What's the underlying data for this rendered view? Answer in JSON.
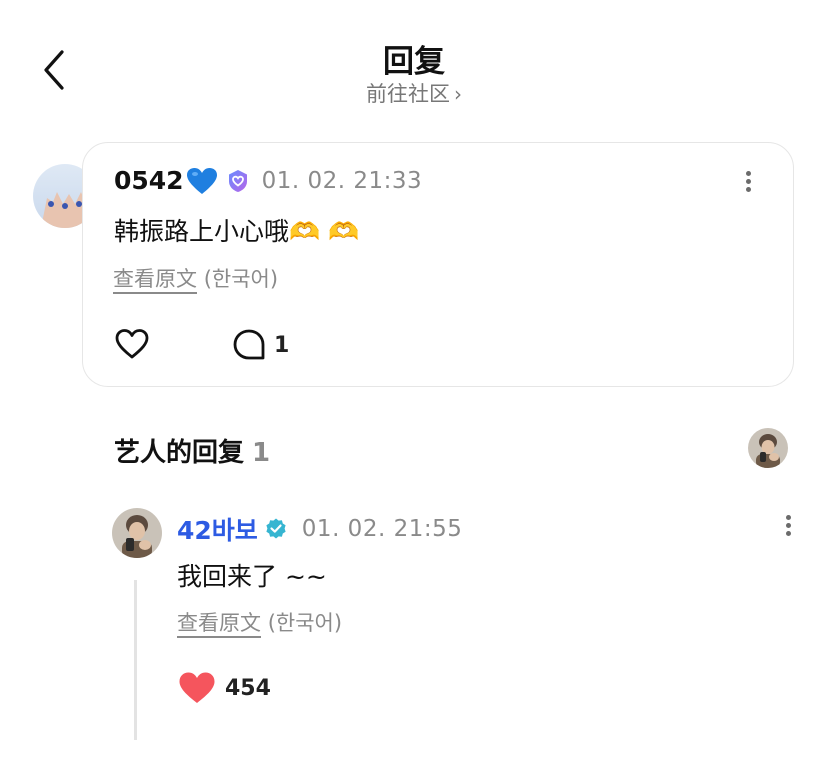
{
  "header": {
    "title": "回复",
    "subtitle": "前往社区",
    "subtitle_chevron": "›"
  },
  "comment": {
    "username": "0542",
    "time": "01. 02. 21:33",
    "text": "韩振路上小心哦🫶 🫶",
    "translate_link": "查看原文",
    "translate_lang": "(한국어)",
    "reply_count": "1"
  },
  "artist_section": {
    "title": "艺人的回复",
    "count": "1"
  },
  "reply": {
    "username": "42바보",
    "time": "01. 02. 21:55",
    "text": "我回来了 ~~",
    "translate_link": "查看原文",
    "translate_lang": "(한국어)",
    "like_count": "454"
  },
  "colors": {
    "accent_blue": "#2d5be3",
    "verified_teal": "#36b5d1",
    "like_red": "#f5555d",
    "gray_text": "#8a8a8a"
  },
  "icons": [
    "back-icon",
    "chevron-right-icon",
    "blue-heart-emoji",
    "verified-badge-icon",
    "more-icon",
    "heart-outline-icon",
    "comment-icon",
    "heart-filled-icon",
    "heart-hands-emoji"
  ]
}
